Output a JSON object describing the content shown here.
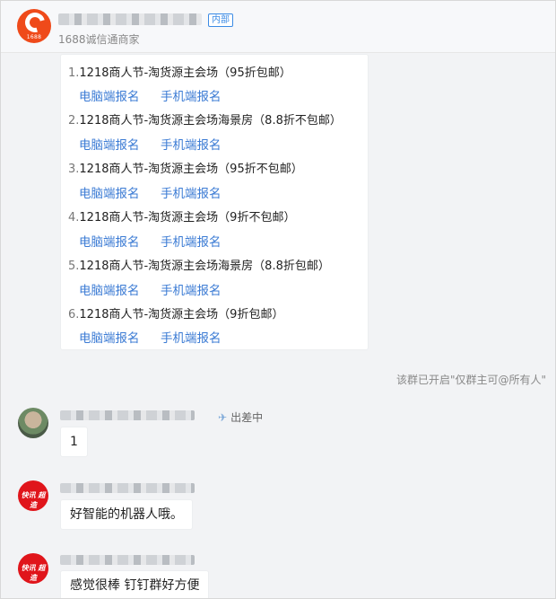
{
  "header": {
    "tag": "内部",
    "subtitle": "1688诚信通商家",
    "logo_text": "1688",
    "accent": "#ef4a1a"
  },
  "message": {
    "items": [
      {
        "index": "1.",
        "title": "1218商人节-淘货源主会场（95折包邮）",
        "pc_link": "电脑端报名",
        "mobile_link": "手机端报名"
      },
      {
        "index": "2.",
        "title": "1218商人节-淘货源主会场海景房（8.8折不包邮）",
        "pc_link": "电脑端报名",
        "mobile_link": "手机端报名"
      },
      {
        "index": "3.",
        "title": "1218商人节-淘货源主会场（95折不包邮）",
        "pc_link": "电脑端报名",
        "mobile_link": "手机端报名"
      },
      {
        "index": "4.",
        "title": "1218商人节-淘货源主会场（9折不包邮）",
        "pc_link": "电脑端报名",
        "mobile_link": "手机端报名"
      },
      {
        "index": "5.",
        "title": "1218商人节-淘货源主会场海景房（8.8折包邮）",
        "pc_link": "电脑端报名",
        "mobile_link": "手机端报名"
      },
      {
        "index": "6.",
        "title": "1218商人节-淘货源主会场（9折包邮）",
        "pc_link": "电脑端报名",
        "mobile_link": "手机端报名"
      }
    ],
    "link_color": "#3b7bd4"
  },
  "system_note": "该群已开启\"仅群主可@所有人\"",
  "chat": [
    {
      "status_icon": "plane-icon",
      "status": "出差中",
      "text": "1"
    },
    {
      "avatar_text": "快讯 超造",
      "text": "好智能的机器人哦。"
    },
    {
      "avatar_text": "快讯 超造",
      "text": "感觉很棒 钉钉群好方便"
    }
  ]
}
